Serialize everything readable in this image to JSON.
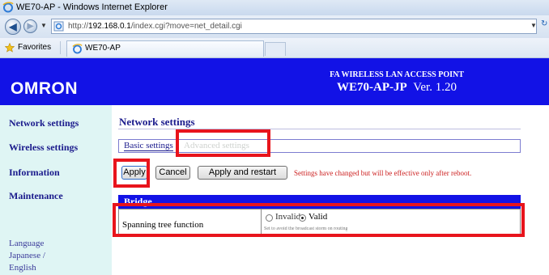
{
  "browser": {
    "window_title": "WE70-AP - Windows Internet Explorer",
    "url_prefix": "http://",
    "url_host": "192.168.0.1",
    "url_path": "/index.cgi?move=net_detail.cgi",
    "favorites_label": "Favorites",
    "tab_label": "WE70-AP"
  },
  "header": {
    "logo": "OMRON",
    "product_subtitle": "FA WIRELESS LAN ACCESS POINT",
    "product_model": "WE70-AP-JP",
    "product_version": "Ver. 1.20",
    "background_color": "#1212e6"
  },
  "sidebar": {
    "items": [
      {
        "label": "Network settings"
      },
      {
        "label": "Wireless settings"
      },
      {
        "label": "Information"
      },
      {
        "label": "Maintenance"
      }
    ],
    "language": {
      "label": "Language",
      "japanese": "Japanese /",
      "english": "English"
    }
  },
  "main": {
    "title": "Network settings",
    "tabs": {
      "basic": "Basic settings",
      "advanced": "Advanced settings"
    },
    "buttons": {
      "apply": "Apply",
      "cancel": "Cancel",
      "apply_restart": "Apply and restart"
    },
    "notice": "Settings have changed but will be effective only after reboot.",
    "section_title": "Bridge",
    "row": {
      "label": "Spanning tree function",
      "option_invalid": "Invalid",
      "option_valid": "Valid",
      "selected": "Valid",
      "hint": "Set to avoid the broadcast storm on routing"
    }
  },
  "annotations": {
    "highlight_color": "#e8141c"
  }
}
